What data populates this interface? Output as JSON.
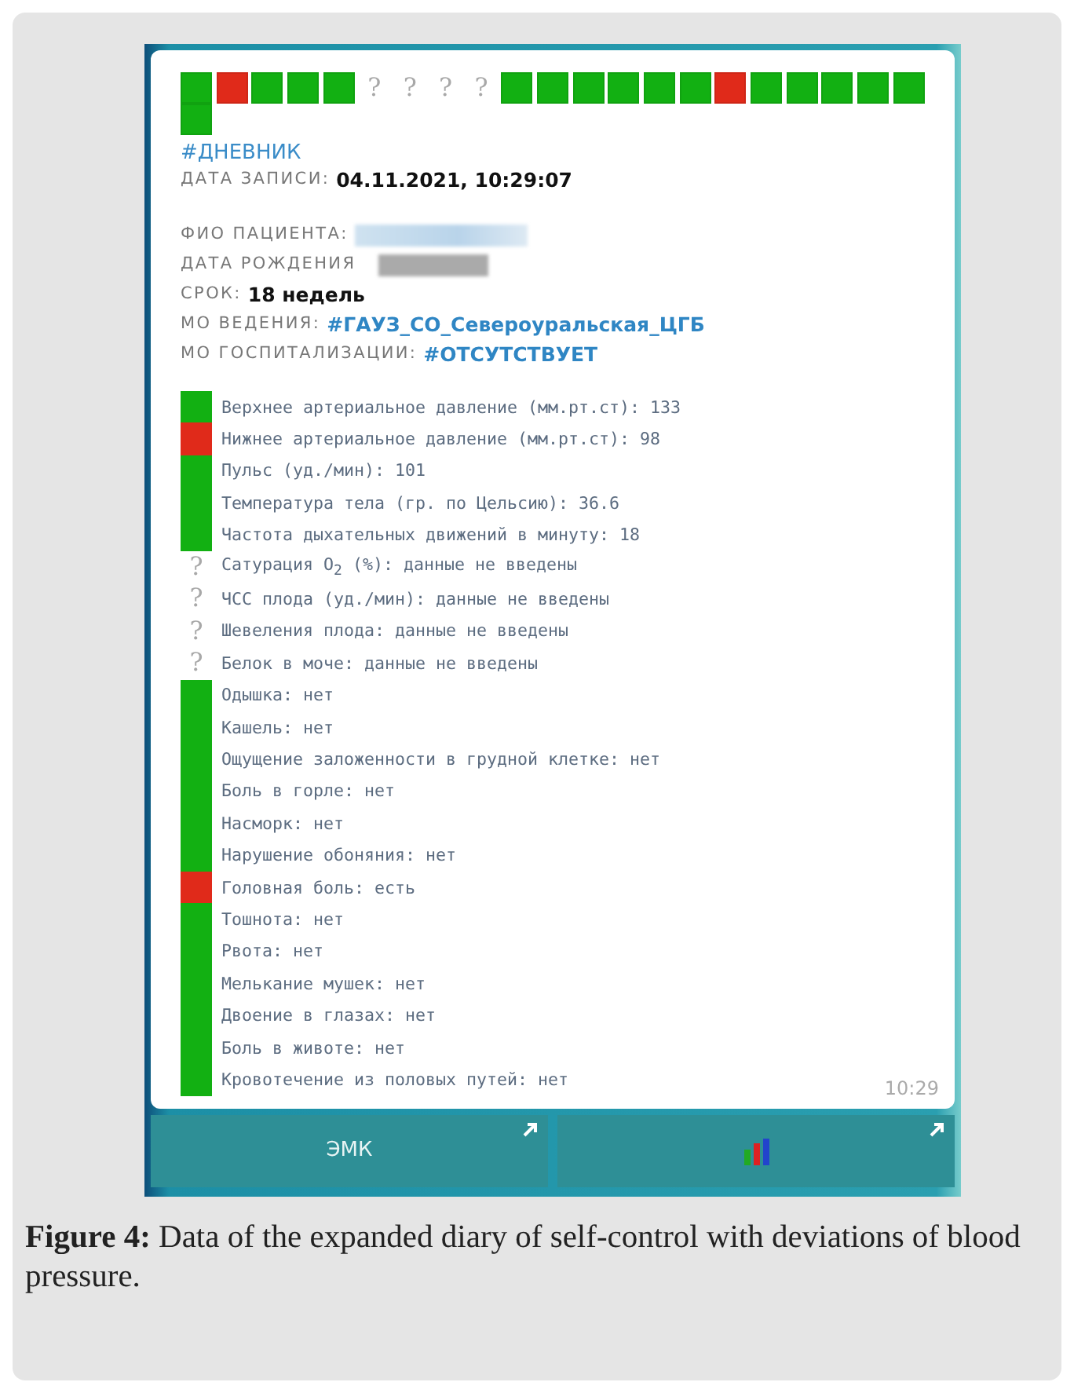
{
  "summary_strip": [
    {
      "color": "#12b012"
    },
    {
      "color": "#e02a1a"
    },
    {
      "color": "#12b012"
    },
    {
      "color": "#12b012"
    },
    {
      "color": "#12b012"
    },
    {
      "mark": "?"
    },
    {
      "mark": "?"
    },
    {
      "mark": "?"
    },
    {
      "mark": "?"
    },
    {
      "color": "#12b012"
    },
    {
      "color": "#12b012"
    },
    {
      "color": "#12b012"
    },
    {
      "color": "#12b012"
    },
    {
      "color": "#12b012"
    },
    {
      "color": "#12b012"
    },
    {
      "color": "#e02a1a"
    },
    {
      "color": "#12b012"
    },
    {
      "color": "#12b012"
    },
    {
      "color": "#12b012"
    },
    {
      "color": "#12b012"
    },
    {
      "color": "#12b012"
    },
    {
      "color": "#12b012"
    }
  ],
  "hashtag": "#ДНЕВНИК",
  "record": {
    "label": "ДАТА ЗАПИСИ:",
    "value": "04.11.2021, 10:29:07"
  },
  "patient_fields": [
    {
      "label": "ФИО ПАЦИЕНТА:",
      "kind": "redacted"
    },
    {
      "label": "ДАТА РОЖДЕНИЯ",
      "kind": "redacted"
    },
    {
      "label": "СРОК:",
      "kind": "text",
      "value": "18 недель"
    },
    {
      "label": "МО ВЕДЕНИЯ:",
      "kind": "link",
      "value": "#ГАУЗ_СО_Североуральская_ЦГБ"
    },
    {
      "label": "МО ГОСПИТАЛИЗАЦИИ:",
      "kind": "link",
      "value": "#ОТСУТСТВУЕТ"
    }
  ],
  "indicators": [
    {
      "text": "Верхнее артериальное давление (мм.рт.ст): 133",
      "color": "#12b012"
    },
    {
      "text": "Нижнее артериальное давление (мм.рт.ст): 98",
      "color": "#e02a1a"
    },
    {
      "text": "Пульс (уд./мин): 101",
      "color": "#12b012"
    },
    {
      "text": "Температура тела (гр. по Цельсию): 36.6",
      "color": "#12b012"
    },
    {
      "text": "Частота дыхательных движений в минуту: 18",
      "color": "#12b012"
    },
    {
      "text": "Сатурация O$_{2}$ (%): данные не введены",
      "mark": "?"
    },
    {
      "text": "ЧСС плода (уд./мин): данные не введены",
      "mark": "?"
    },
    {
      "text": "Шевеления плода: данные не введены",
      "mark": "?"
    },
    {
      "text": "Белок в моче: данные не введены",
      "mark": "?"
    },
    {
      "text": "Одышка: нет",
      "color": "#12b012"
    },
    {
      "text": "Кашель: нет",
      "color": "#12b012"
    },
    {
      "text": "Ощущение заложенности в грудной клетке: нет",
      "color": "#12b012"
    },
    {
      "text": "Боль в горле: нет",
      "color": "#12b012"
    },
    {
      "text": "Насморк: нет",
      "color": "#12b012"
    },
    {
      "text": "Нарушение обоняния: нет",
      "color": "#12b012"
    },
    {
      "text": "Головная боль: есть",
      "color": "#e02a1a"
    },
    {
      "text": "Тошнота: нет",
      "color": "#12b012"
    },
    {
      "text": "Рвота: нет",
      "color": "#12b012"
    },
    {
      "text": "Мелькание мушек: нет",
      "color": "#12b012"
    },
    {
      "text": "Двоение в глазах: нет",
      "color": "#12b012"
    },
    {
      "text": "Боль в животе: нет",
      "color": "#12b012"
    },
    {
      "text": "Кровотечение из половых путей: нет",
      "color": "#12b012"
    }
  ],
  "time": "10:29",
  "buttons": [
    {
      "kind": "text",
      "label": "ЭМК"
    },
    {
      "kind": "chart"
    }
  ],
  "caption": "**Figure 4:** Data of the expanded diary of self-control with deviations of blood pressure."
}
